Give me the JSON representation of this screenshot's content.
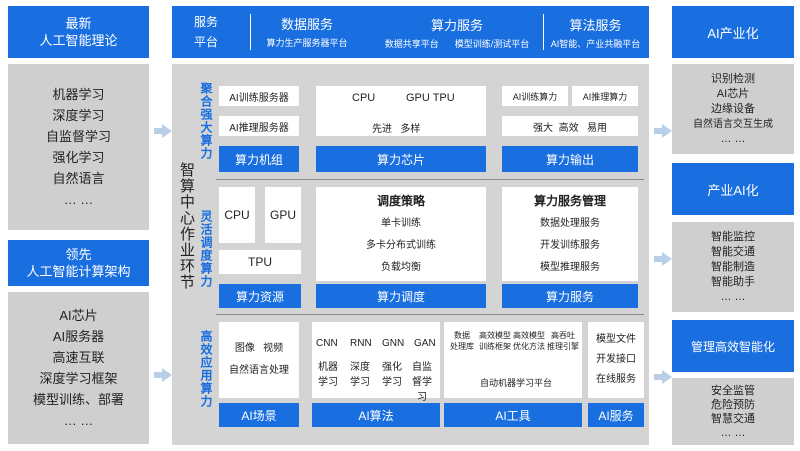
{
  "left": {
    "box1_title": [
      "最新",
      "人工智能理论"
    ],
    "box1_items": [
      "机器学习",
      "深度学习",
      "自监督学习",
      "强化学习",
      "自然语言",
      "… …"
    ],
    "box2_title": [
      "领先",
      "人工智能计算架构"
    ],
    "box2_items": [
      "AI芯片",
      "AI服务器",
      "高速互联",
      "深度学习框架",
      "模型训练、部署",
      "… …"
    ]
  },
  "top": {
    "service_label": [
      "服务",
      "平台"
    ],
    "data_service": {
      "title": "数据服务",
      "sub": "算力生产服务器平台"
    },
    "compute_service": {
      "title": "算力服务",
      "subs": [
        "数据共享平台",
        "模型训练/测试平台"
      ]
    },
    "algo_service": {
      "title": "算法服务",
      "sub": "AI智能、产业共融平台"
    }
  },
  "center": {
    "side_title": "智算中心作业环节",
    "band1_label": "聚合强大算力",
    "band2_label": "灵活调度算力",
    "band3_label": "高效应用算力",
    "band1": {
      "box1_items": [
        "AI训练服务器",
        "AI推理服务器"
      ],
      "box1_footer": "算力机组",
      "box2_row1": [
        "CPU",
        "GPU TPU"
      ],
      "box2_row2": "先进   多样",
      "box2_footer": "算力芯片",
      "box3_row1": [
        "AI训练算力",
        "AI推理算力"
      ],
      "box3_row2": "强大  高效   易用",
      "box3_footer": "算力输出"
    },
    "band2": {
      "res_items": [
        "CPU",
        "GPU",
        "TPU"
      ],
      "res_footer": "算力资源",
      "sched_title": "调度策略",
      "sched_items": [
        "单卡训练",
        "多卡分布式训练",
        "负载均衡"
      ],
      "sched_footer": "算力调度",
      "svc_title": "算力服务管理",
      "svc_items": [
        "数据处理服务",
        "开发训练服务",
        "模型推理服务"
      ],
      "svc_footer": "算力服务"
    },
    "band3": {
      "scene_items": [
        "图像   视频",
        "自然语言处理"
      ],
      "scene_footer": "AI场景",
      "algo_top": [
        "CNN",
        "RNN",
        "GNN",
        "GAN"
      ],
      "algo_bottom": [
        [
          "机器",
          "学习"
        ],
        [
          "深度",
          "学习"
        ],
        [
          "强化",
          "学习"
        ],
        [
          "自监",
          "督学",
          "习"
        ]
      ],
      "algo_footer": "AI算法",
      "tool_top": [
        [
          "数据",
          "处理库"
        ],
        [
          "高效模型",
          "训练框架"
        ],
        [
          "高效模型",
          "优化方法"
        ],
        [
          "高吞吐",
          "推理引擎"
        ]
      ],
      "tool_bottom": "自动机器学习平台",
      "tool_footer": "AI工具",
      "svc_items": [
        "模型文件",
        "开发接口",
        "在线服务"
      ],
      "svc_footer": "AI服务"
    }
  },
  "right": {
    "box1_title": "AI产业化",
    "box1_items": [
      "识别检测",
      "AI芯片",
      "边缘设备",
      "自然语言交互生成",
      "… …"
    ],
    "box2_title": "产业AI化",
    "box2_items": [
      "智能监控",
      "智能交通",
      "智能制造",
      "智能助手",
      "… …"
    ],
    "box3_title": "管理高效智能化",
    "box3_items": [
      "安全监管",
      "危险预防",
      "智慧交通",
      "… …"
    ]
  },
  "colors": {
    "accent_blue": "#1a6fe0",
    "panel_gray": "#d2d2d2",
    "label_blue": "#1a6fe0",
    "arrow": "#b9cfe8"
  }
}
